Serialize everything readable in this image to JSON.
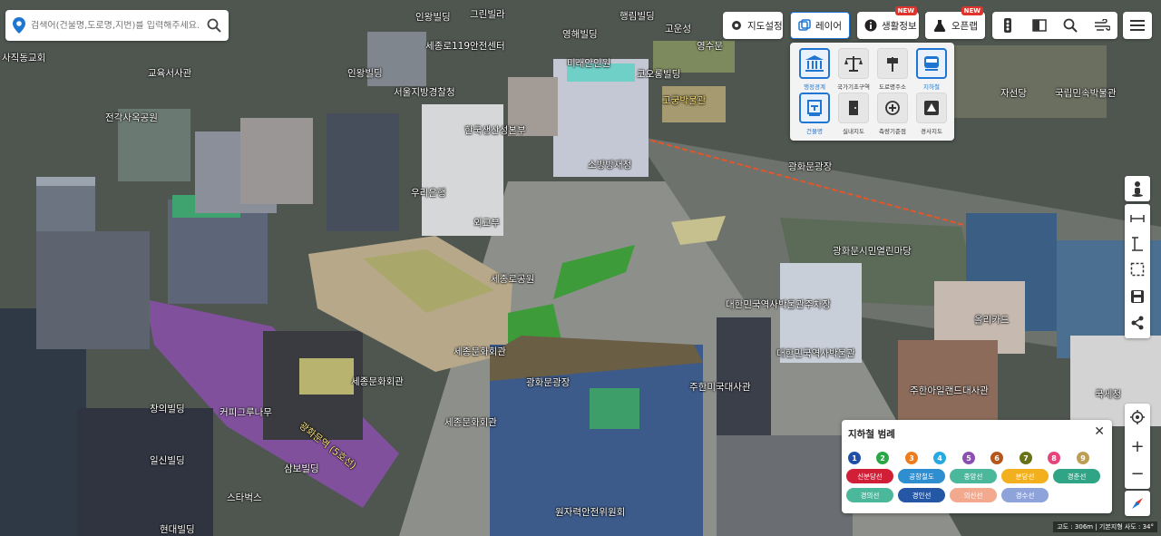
{
  "search": {
    "placeholder": "검색어(건물명,도로명,지번)를 입력해주세요."
  },
  "toolbar": {
    "map_settings": "지도설정",
    "layers": "레이어",
    "life_info": "생활정보",
    "openapi": "오픈랩",
    "new_badge": "NEW"
  },
  "layer_panel": {
    "items": [
      {
        "label": "행정경계",
        "active": true
      },
      {
        "label": "국가기초구역",
        "active": false
      },
      {
        "label": "도로명주소",
        "active": false
      },
      {
        "label": "지하철",
        "active": true
      },
      {
        "label": "건물명",
        "active": true
      },
      {
        "label": "실내지도",
        "active": false
      },
      {
        "label": "측량기준점",
        "active": false
      },
      {
        "label": "경사지도",
        "active": false
      }
    ]
  },
  "map_labels": [
    {
      "text": "사직동교회"
    },
    {
      "text": "인왕빌딩"
    },
    {
      "text": "그린빌라"
    },
    {
      "text": "행림빌딩"
    },
    {
      "text": "세종로119안전센터"
    },
    {
      "text": "영해빌딩"
    },
    {
      "text": "고운성"
    },
    {
      "text": "영수문"
    },
    {
      "text": "미래안인원"
    },
    {
      "text": "코오롱빌딩"
    },
    {
      "text": "인왕빌딩"
    },
    {
      "text": "서울지방경찰청"
    },
    {
      "text": "교육서사관"
    },
    {
      "text": "전각사옥공원"
    },
    {
      "text": "한국생산성본부"
    },
    {
      "text": "고궁박물관"
    },
    {
      "text": "자선당"
    },
    {
      "text": "국립민속박물관"
    },
    {
      "text": "소방방재청"
    },
    {
      "text": "광화문광장"
    },
    {
      "text": "우리은행"
    },
    {
      "text": "외교부"
    },
    {
      "text": "광화문시민열린마당"
    },
    {
      "text": "세종로공원"
    },
    {
      "text": "대한민국역사박물관주차장"
    },
    {
      "text": "대한민국역사박물관"
    },
    {
      "text": "세종문화회관"
    },
    {
      "text": "광화문광장"
    },
    {
      "text": "주한미국대사관"
    },
    {
      "text": "올리카드"
    },
    {
      "text": "세종문화회관"
    },
    {
      "text": "커피그루나무"
    },
    {
      "text": "광화문역 (5호선)"
    },
    {
      "text": "세종문화회관"
    },
    {
      "text": "삼보빌딩"
    },
    {
      "text": "일신빌딩"
    },
    {
      "text": "스타벅스"
    },
    {
      "text": "현대빌딩"
    },
    {
      "text": "원자력안전위원회"
    },
    {
      "text": "주한아일랜드대사관"
    },
    {
      "text": "국세청"
    },
    {
      "text": "창의빌딩"
    }
  ],
  "legend": {
    "title": "지하철 범례",
    "close": "✕",
    "numbers": [
      {
        "n": "1",
        "color": "#1f4fa8"
      },
      {
        "n": "2",
        "color": "#27a845"
      },
      {
        "n": "3",
        "color": "#ef7c1c"
      },
      {
        "n": "4",
        "color": "#26a9e0"
      },
      {
        "n": "5",
        "color": "#8a4fb0"
      },
      {
        "n": "6",
        "color": "#b5561d"
      },
      {
        "n": "7",
        "color": "#697117"
      },
      {
        "n": "8",
        "color": "#e6447b"
      },
      {
        "n": "9",
        "color": "#bd9e55"
      }
    ],
    "lines": [
      {
        "name": "신분당선",
        "color": "#d11f37"
      },
      {
        "name": "공항철도",
        "color": "#2f8ed0"
      },
      {
        "name": "중앙선",
        "color": "#4bb89c"
      },
      {
        "name": "분당선",
        "color": "#f2b01e"
      },
      {
        "name": "경춘선",
        "color": "#2fa586"
      },
      {
        "name": "경의선",
        "color": "#4bb89c"
      },
      {
        "name": "경인선",
        "color": "#2457a6"
      },
      {
        "name": "의신선",
        "color": "#f2a98e"
      },
      {
        "name": "경수선",
        "color": "#8ea3d9"
      }
    ]
  },
  "scale": {
    "text": "고도 : 306m  |  기본지형 사도 : 34°"
  }
}
